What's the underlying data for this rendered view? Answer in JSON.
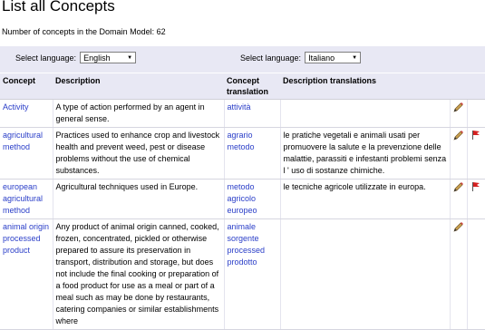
{
  "page": {
    "title": "List all Concepts",
    "count_label": "Number of concepts in the Domain Model: 62"
  },
  "language_bar": {
    "left_label": "Select language:",
    "left_value": "English",
    "right_label": "Select language:",
    "right_value": "Italiano"
  },
  "table": {
    "headers": {
      "concept": "Concept",
      "description": "Description",
      "concept_translation_line1": "Concept",
      "concept_translation_line2": "translation",
      "description_translations": "Description translations"
    },
    "rows": [
      {
        "concept": "Activity",
        "description": "A type of action performed by an agent in general sense.",
        "translation": "attività",
        "description_translation": "",
        "has_delete": false
      },
      {
        "concept": "agricultural method",
        "description": "Practices used to enhance crop and livestock health and prevent weed, pest or disease problems without the use of chemical substances.",
        "translation": "agrario metodo",
        "description_translation": "le pratiche vegetali e animali usati per promuovere la salute e la prevenzione delle malattie, parassiti e infestanti problemi senza l ' uso di sostanze chimiche.",
        "has_delete": true
      },
      {
        "concept": "european agricultural method",
        "description": "Agricultural techniques used in Europe.",
        "translation": "metodo agricolo europeo",
        "description_translation": "le tecniche agricole utilizzate in europa.",
        "has_delete": true
      },
      {
        "concept": "animal origin processed product",
        "description": "Any product of animal origin canned, cooked, frozen, concentrated, pickled or otherwise prepared to assure its preservation in transport, distribution and storage, but does not include the final cooking or preparation of a food product for use as a meal or part of a meal such as may be done by restaurants, catering companies or similar establishments where",
        "translation": "animale sorgente processed prodotto",
        "description_translation": "",
        "has_delete": false
      }
    ]
  },
  "colors": {
    "link": "#2a3ec8",
    "header_bg": "#e8e8f4",
    "delete_flag": "#d42020"
  },
  "icons": {
    "edit": "pencil-icon",
    "delete": "red-flag-icon"
  }
}
